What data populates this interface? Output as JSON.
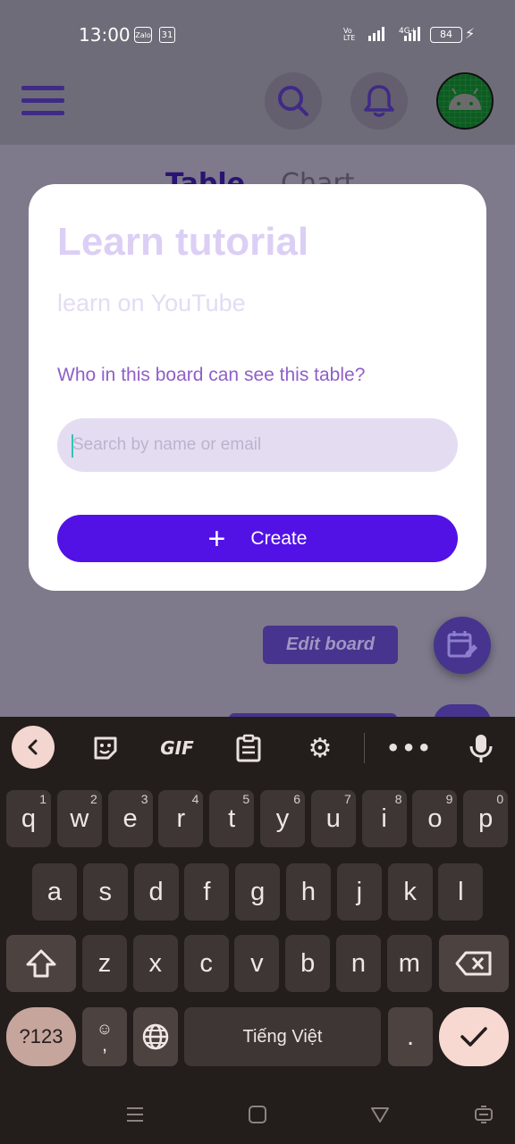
{
  "status_bar": {
    "time": "13:00",
    "zalo_label": "Zalo",
    "calendar_label": "31",
    "volte_label": "Vo LTE",
    "network_label": "4G+",
    "battery": "84"
  },
  "app_bar": {
    "menu_icon": "hamburger-icon",
    "search_icon": "search-icon",
    "notification_icon": "bell-icon",
    "avatar_icon": "android-avatar"
  },
  "background_tabs": [
    "Table",
    "Chart"
  ],
  "modal": {
    "title": "Learn tutorial",
    "subtitle": "learn on YouTube",
    "question": "Who in this board can see this table?",
    "search_placeholder": "Search by name or email",
    "search_value": "",
    "create_label": "Create"
  },
  "background": {
    "edit_board_label": "Edit board"
  },
  "keyboard": {
    "toolbar": [
      "back",
      "sticker",
      "GIF",
      "clipboard",
      "settings",
      "more",
      "mic"
    ],
    "gif_label": "GIF",
    "row1": [
      {
        "k": "q",
        "n": "1"
      },
      {
        "k": "w",
        "n": "2"
      },
      {
        "k": "e",
        "n": "3"
      },
      {
        "k": "r",
        "n": "4"
      },
      {
        "k": "t",
        "n": "5"
      },
      {
        "k": "y",
        "n": "6"
      },
      {
        "k": "u",
        "n": "7"
      },
      {
        "k": "i",
        "n": "8"
      },
      {
        "k": "o",
        "n": "9"
      },
      {
        "k": "p",
        "n": "0"
      }
    ],
    "row2": [
      "a",
      "s",
      "d",
      "f",
      "g",
      "h",
      "j",
      "k",
      "l"
    ],
    "row3": [
      "z",
      "x",
      "c",
      "v",
      "b",
      "n",
      "m"
    ],
    "symbols_label": "?123",
    "emoji_comma_label": ",",
    "space_label": "Tiếng Việt",
    "period_label": "."
  },
  "colors": {
    "accent": "#5212e6",
    "title": "#dccff5",
    "question": "#8f5fc9"
  }
}
